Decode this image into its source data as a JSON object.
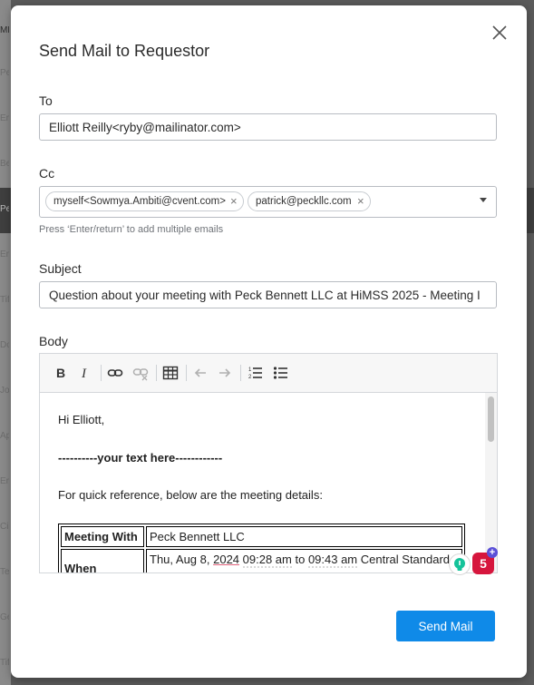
{
  "background": {
    "fragments": [
      "ME",
      "Pet",
      "Eric",
      "Bea",
      "Pec",
      "Eric",
      "Tiff",
      "Do",
      "Jos",
      "Ap",
      "Eric",
      "Cis",
      "Tes",
      "Ge",
      "Tiff"
    ]
  },
  "modal": {
    "title": "Send Mail to Requestor",
    "close_icon": "close-icon"
  },
  "to": {
    "label": "To",
    "value": "Elliott Reilly<ryby@mailinator.com>"
  },
  "cc": {
    "label": "Cc",
    "chips": [
      {
        "text": "myself<Sowmya.Ambiti@cvent.com>"
      },
      {
        "text": "patrick@peckllc.com"
      }
    ],
    "hint": "Press ‘Enter/return’ to add multiple emails"
  },
  "subject": {
    "label": "Subject",
    "value": "Question about your meeting with Peck Bennett LLC at HiMSS 2025 - Meeting I"
  },
  "body": {
    "label": "Body",
    "toolbar": [
      "bold-icon",
      "italic-icon",
      "link-icon",
      "unlink-icon",
      "table-icon",
      "undo-icon",
      "redo-icon",
      "numbered-list-icon",
      "bulleted-list-icon"
    ],
    "greeting": "Hi Elliott,",
    "placeholder_line": "----------your text here------------",
    "reference_line": "For quick reference, below are the meeting details:",
    "table": {
      "rows": [
        {
          "key": "Meeting With",
          "value": "Peck Bennett LLC"
        },
        {
          "key": "When",
          "value_parts": [
            "Thu, Aug 8, ",
            "2024",
            " ",
            "09:28 am",
            " to ",
            "09:43 am",
            " Central Standard"
          ]
        }
      ]
    }
  },
  "grammarly": {
    "badge_count": "5",
    "plus": "+"
  },
  "actions": {
    "send_label": "Send Mail"
  },
  "colors": {
    "primary_button": "#0f8ae8",
    "grammarly_red": "#d6163d",
    "grammarly_green": "#15c39a",
    "grammarly_purple": "#5b50d8"
  }
}
